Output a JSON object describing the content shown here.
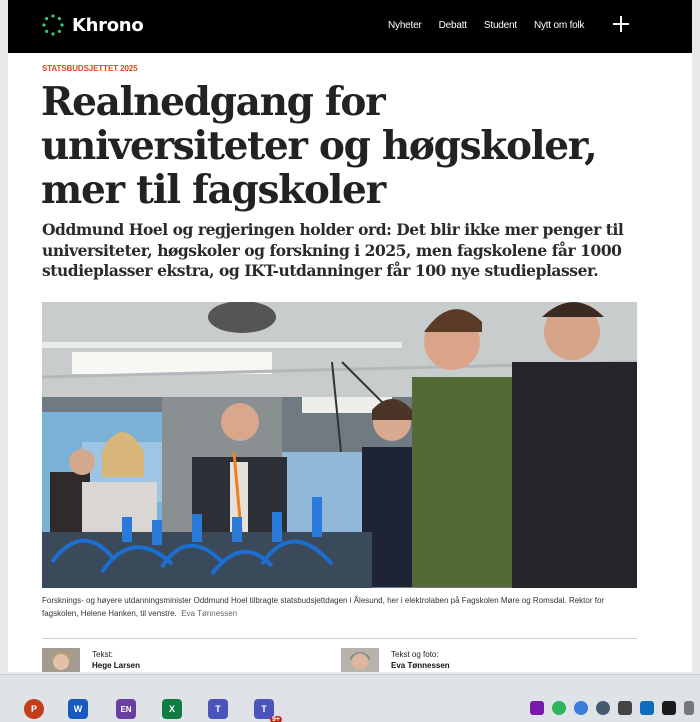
{
  "header": {
    "logo_text": "Khrono",
    "nav": [
      "Nyheter",
      "Debatt",
      "Student",
      "Nytt om folk"
    ]
  },
  "article": {
    "kicker": "STATSBUDSJETTET 2025",
    "headline": "Realnedgang for universiteter og høgskoler, mer til fagskoler",
    "lead": "Oddmund Hoel og regjeringen holder ord: Det blir ikke mer penger til universiteter, høgskoler og forskning i 2025, men fagskolene får 1000 studieplasser ekstra, og IKT-utdanninger får 100 nye studieplasser.",
    "caption": "Forsknings- og høyere utdanningsminister Oddmund Hoel tilbragte statsbudsjettdagen i Ålesund, her i elektrolaben på Fagskolen Møre og Romsdal. Rektor for fagskolen, Helene Hanken, til venstre.",
    "photo_credit": "Eva Tønnessen",
    "authors": [
      {
        "role": "Tekst:",
        "name": "Hege Larsen"
      },
      {
        "role": "Tekst og foto:",
        "name": "Eva Tønnessen"
      }
    ]
  },
  "taskbar": {
    "apps": [
      {
        "name": "PowerPoint",
        "letter": "P",
        "color": "#c43e1c"
      },
      {
        "name": "Word",
        "letter": "W",
        "color": "#185abd"
      },
      {
        "name": "EN",
        "letter": "EN",
        "color": "#6b3fa0"
      },
      {
        "name": "Excel",
        "letter": "X",
        "color": "#107c41"
      },
      {
        "name": "Teams",
        "letter": "T",
        "color": "#4b53bc"
      },
      {
        "name": "Teams",
        "letter": "T",
        "color": "#4b53bc",
        "badge": "9+"
      }
    ]
  }
}
